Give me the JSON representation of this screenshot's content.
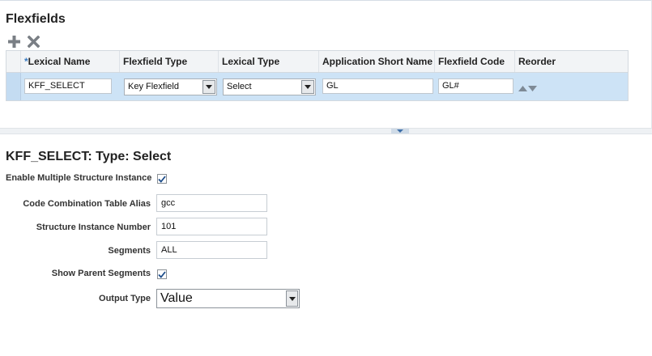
{
  "page": {
    "title": "Flexfields"
  },
  "toolbar": {
    "add_icon": "plus-icon",
    "delete_icon": "x-icon"
  },
  "table": {
    "required_marker": "*",
    "columns": [
      "Lexical Name",
      "Flexfield Type",
      "Lexical Type",
      "Application Short Name",
      "Flexfield Code",
      "Reorder"
    ],
    "rows": [
      {
        "lexical_name": "KFF_SELECT",
        "flexfield_type": "Key Flexfield",
        "lexical_type": "Select",
        "application_short_name": "GL",
        "flexfield_code": "GL#"
      }
    ]
  },
  "detail": {
    "title": "KFF_SELECT: Type: Select",
    "enable_multiple_label": "Enable Multiple Structure Instance",
    "enable_multiple_checked": true,
    "alias_label": "Code Combination Table Alias",
    "alias_value": "gcc",
    "structure_label": "Structure Instance Number",
    "structure_value": "101",
    "segments_label": "Segments",
    "segments_value": "ALL",
    "show_parent_label": "Show Parent Segments",
    "show_parent_checked": true,
    "output_type_label": "Output Type",
    "output_type_value": "Value"
  }
}
